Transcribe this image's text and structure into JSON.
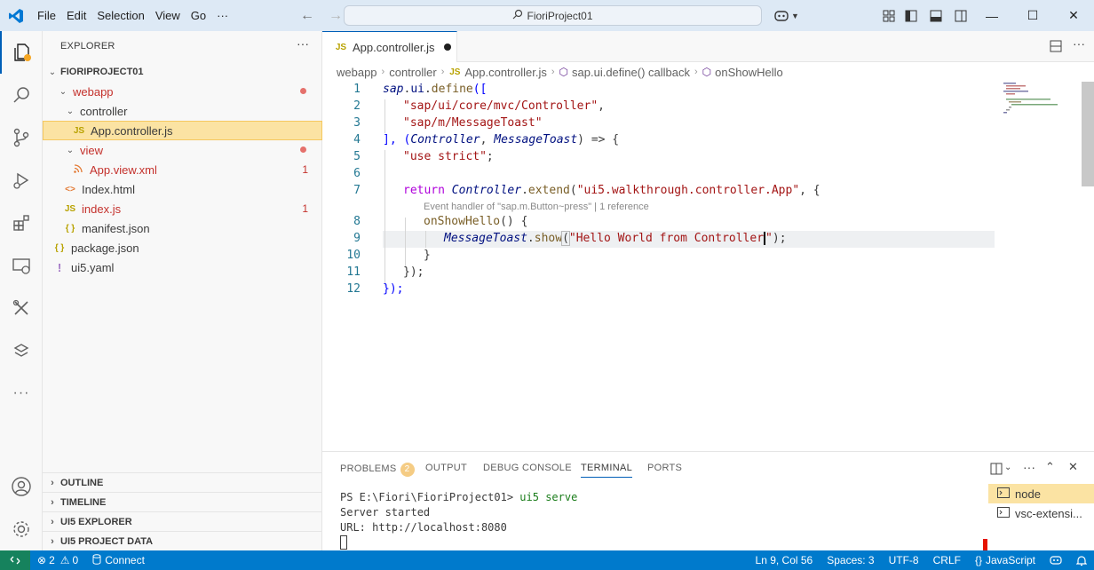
{
  "window": {
    "title": "FioriProject01",
    "menus": [
      "File",
      "Edit",
      "Selection",
      "View",
      "Go",
      "···"
    ]
  },
  "sidebar": {
    "title": "EXPLORER",
    "more": "···",
    "root": "FIORIPROJECT01",
    "tree": [
      {
        "label": "webapp",
        "type": "folder",
        "status": "dot"
      },
      {
        "label": "controller",
        "type": "folder"
      },
      {
        "label": "App.controller.js",
        "type": "file",
        "icon": "JS",
        "selected": true
      },
      {
        "label": "view",
        "type": "folder",
        "status": "dot"
      },
      {
        "label": "App.view.xml",
        "type": "file",
        "icon": "rss",
        "badge": "1"
      },
      {
        "label": "Index.html",
        "type": "file",
        "icon": "<>"
      },
      {
        "label": "index.js",
        "type": "file",
        "icon": "JS",
        "badge": "1"
      },
      {
        "label": "manifest.json",
        "type": "file",
        "icon": "{ }"
      },
      {
        "label": "package.json",
        "type": "file",
        "icon": "{ }"
      },
      {
        "label": "ui5.yaml",
        "type": "file",
        "icon": "!"
      }
    ],
    "sections": [
      "OUTLINE",
      "TIMELINE",
      "UI5 EXPLORER",
      "UI5 PROJECT DATA"
    ]
  },
  "editor": {
    "tab": {
      "label": "App.controller.js",
      "icon": "JS"
    },
    "breadcrumb": [
      "webapp",
      "controller",
      "App.controller.js",
      "sap.ui.define() callback",
      "onShowHello"
    ],
    "codelens": "Event handler of \"sap.m.Button~press\" | 1 reference",
    "line_numbers": [
      "1",
      "2",
      "3",
      "4",
      "5",
      "6",
      "7",
      "8",
      "9",
      "10",
      "11",
      "12"
    ],
    "code": {
      "l1a": "sap",
      "l1b": ".",
      "l1c": "ui",
      "l1d": ".",
      "l1e": "define",
      "l1f": "([",
      "l2": "\"sap/ui/core/mvc/Controller\"",
      "l2c": ",",
      "l3": "\"sap/m/MessageToast\"",
      "l4a": "], (",
      "l4b": "Controller",
      "l4c": ", ",
      "l4d": "MessageToast",
      "l4e": ") => {",
      "l5": "\"use strict\"",
      "l5b": ";",
      "l7a": "return",
      "l7b": "Controller",
      "l7c": ".",
      "l7d": "extend",
      "l7e": "(",
      "l7f": "\"ui5.walkthrough.controller.App\"",
      "l7g": ", {",
      "l8a": "onShowHello",
      "l8b": "() {",
      "l9a": "MessageToast",
      "l9b": ".",
      "l9c": "show",
      "l9d": "(",
      "l9e": "\"Hello World from Controller",
      "l9f": "\"",
      "l9g": ");",
      "l10": "}",
      "l11": "});",
      "l12": "});"
    }
  },
  "panel": {
    "tabs": [
      "PROBLEMS",
      "OUTPUT",
      "DEBUG CONSOLE",
      "TERMINAL",
      "PORTS"
    ],
    "problems_count": "2",
    "terminal_lines": [
      "PS E:\\Fiori\\FioriProject01> ui5 serve",
      "Server started",
      "URL: http://localhost:8080"
    ],
    "prompt_prefix": "PS E:\\Fiori\\FioriProject01> ",
    "prompt_cmd": "ui5 serve",
    "terminals": [
      "node",
      "vsc-extensi..."
    ]
  },
  "statusbar": {
    "errors": "2",
    "warnings": "0",
    "connect": "Connect",
    "position": "Ln 9, Col 56",
    "spaces": "Spaces: 3",
    "encoding": "UTF-8",
    "eol": "CRLF",
    "language": "JavaScript"
  },
  "colors": {
    "accent": "#005fb8",
    "statusbar": "#007acc",
    "titlebar": "#dde9f5",
    "selection": "#fbe3a3",
    "remote": "#16825d"
  }
}
